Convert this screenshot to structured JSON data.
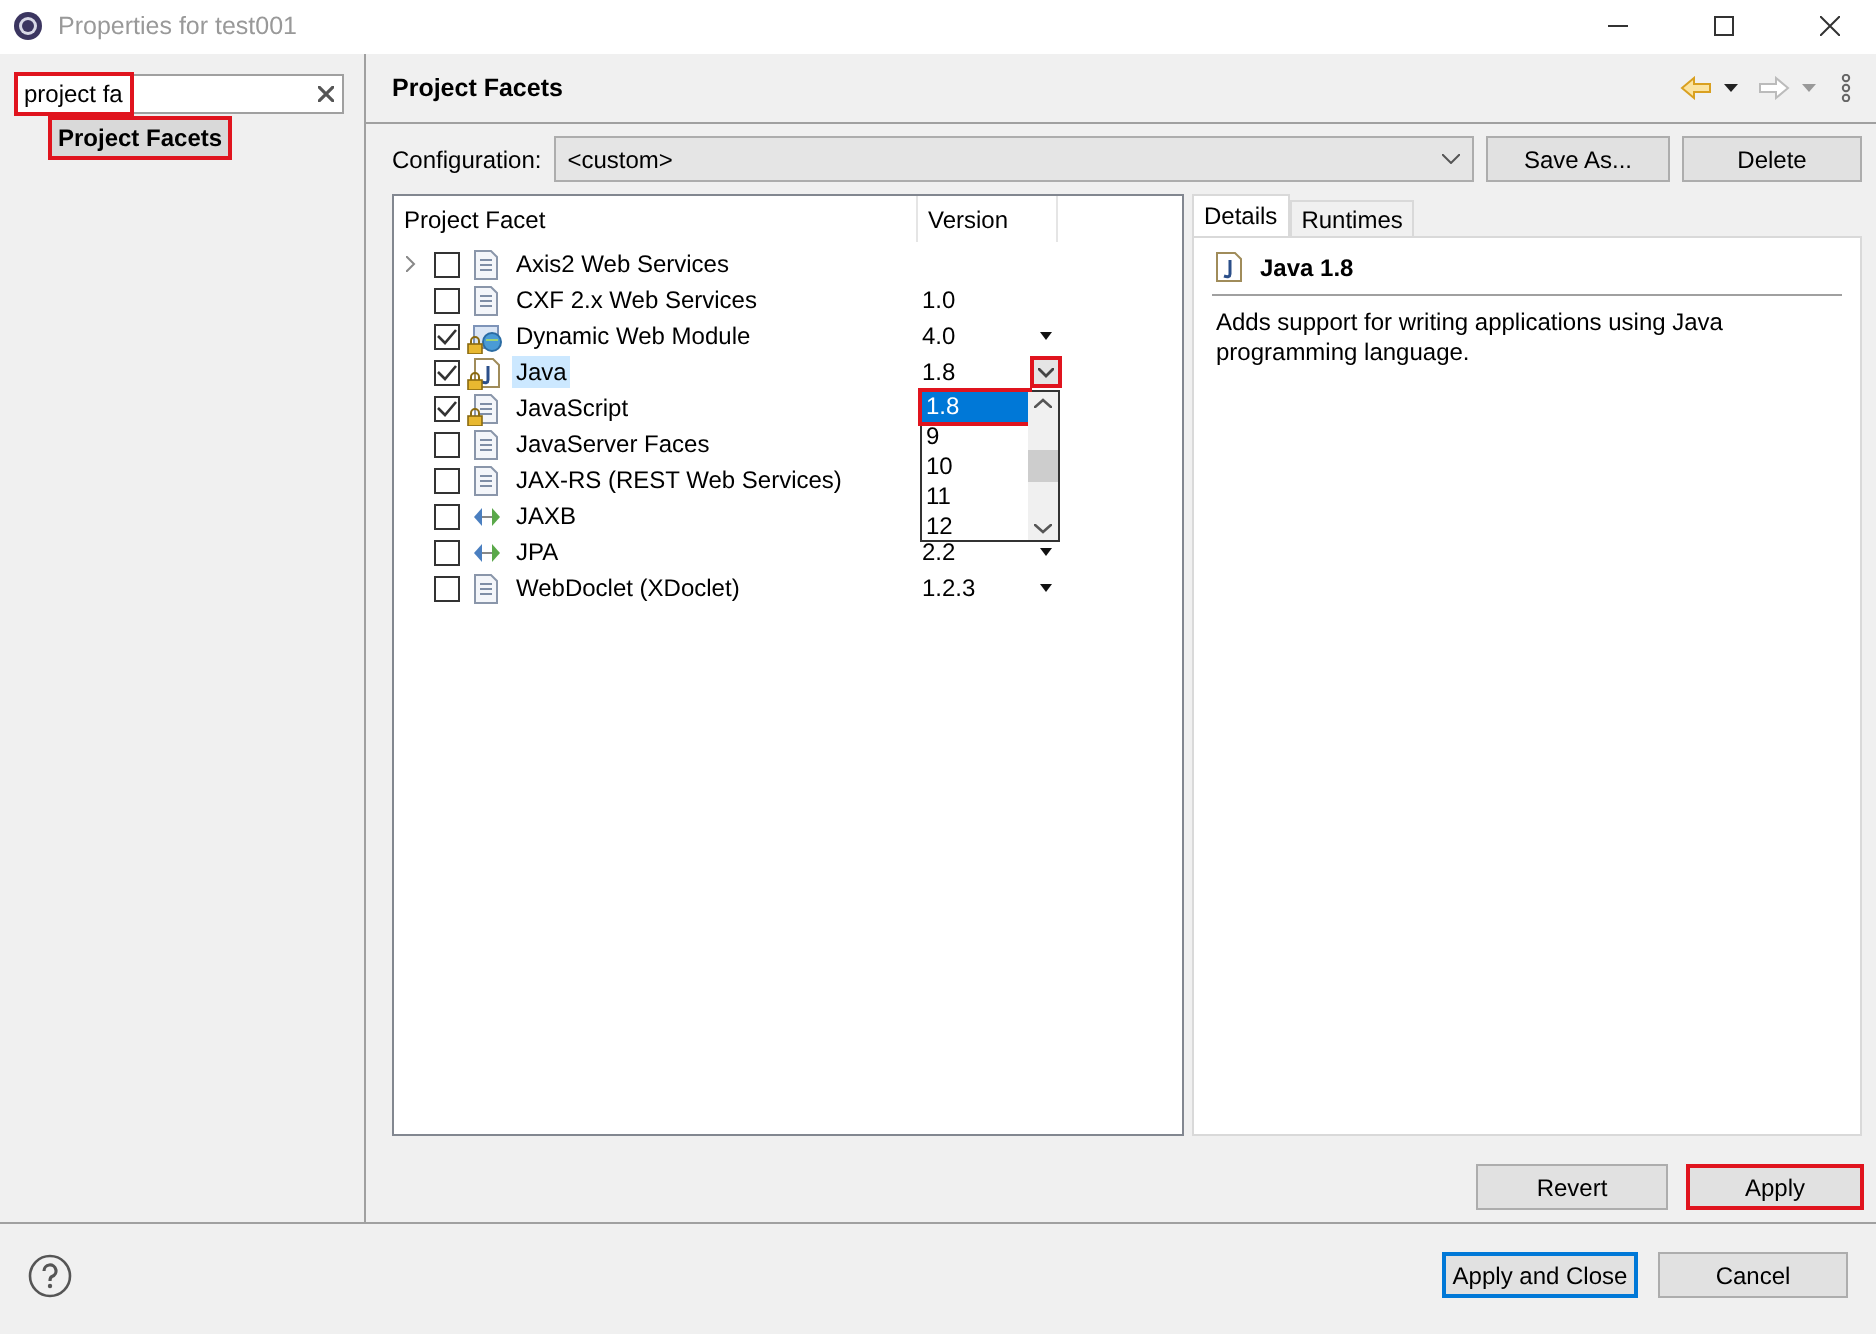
{
  "window": {
    "title": "Properties for test001"
  },
  "filter": {
    "value": "project fa",
    "highlighted": true
  },
  "nav": [
    {
      "label": "Project Facets",
      "selected": true,
      "highlighted": true
    }
  ],
  "page": {
    "title": "Project Facets"
  },
  "configuration": {
    "label": "Configuration:",
    "value": "<custom>"
  },
  "config_buttons": [
    "Save As...",
    "Delete"
  ],
  "table": {
    "columns": [
      "Project Facet",
      "Version"
    ],
    "rows": [
      {
        "name": "Axis2 Web Services",
        "checked": false,
        "kind": "doc",
        "expandable": true,
        "selected": false,
        "has_menu": false
      },
      {
        "name": "CXF 2.x Web Services",
        "checked": false,
        "kind": "doc",
        "expandable": false,
        "selected": false,
        "version": "1.0",
        "has_menu": false
      },
      {
        "name": "Dynamic Web Module",
        "checked": true,
        "kind": "module",
        "expandable": false,
        "selected": false,
        "version": "4.0",
        "has_menu": true
      },
      {
        "name": "Java",
        "checked": true,
        "kind": "java",
        "expandable": false,
        "selected": true,
        "version": "1.8",
        "has_menu": true,
        "highlighted": true
      },
      {
        "name": "JavaScript",
        "checked": true,
        "kind": "doc",
        "expandable": false,
        "selected": false,
        "has_menu": false
      },
      {
        "name": "JavaServer Faces",
        "checked": false,
        "kind": "doc",
        "expandable": false,
        "selected": false,
        "has_menu": false
      },
      {
        "name": "JAX-RS (REST Web Services)",
        "checked": false,
        "kind": "doc",
        "expandable": false,
        "selected": false,
        "has_menu": false
      },
      {
        "name": "JAXB",
        "checked": false,
        "kind": "binding",
        "expandable": false,
        "selected": false,
        "has_menu": false
      },
      {
        "name": "JPA",
        "checked": false,
        "kind": "binding",
        "expandable": false,
        "selected": false,
        "version": "2.2",
        "has_menu": true
      },
      {
        "name": "WebDoclet (XDoclet)",
        "checked": false,
        "kind": "doc",
        "expandable": false,
        "selected": false,
        "version": "1.2.3",
        "has_menu": true
      }
    ]
  },
  "version_menu": {
    "items": [
      {
        "label": "1.8",
        "selected": true,
        "highlighted": true
      },
      {
        "label": "9",
        "selected": false,
        "highlighted": false
      },
      {
        "label": "10",
        "selected": false,
        "highlighted": false
      },
      {
        "label": "11",
        "selected": false,
        "highlighted": false
      },
      {
        "label": "12",
        "selected": false,
        "highlighted": false
      }
    ]
  },
  "details": {
    "tabs": [
      {
        "label": "Details",
        "selected": true
      },
      {
        "label": "Runtimes",
        "selected": false
      }
    ],
    "heading": "Java 1.8",
    "description": "Adds support for writing applications using Java programming language."
  },
  "page_buttons": [
    {
      "label": "Revert",
      "highlighted": false
    },
    {
      "label": "Apply",
      "highlighted": true
    }
  ],
  "dialog_buttons": [
    {
      "label": "Apply and Close",
      "default": true
    },
    {
      "label": "Cancel",
      "default": false
    }
  ]
}
